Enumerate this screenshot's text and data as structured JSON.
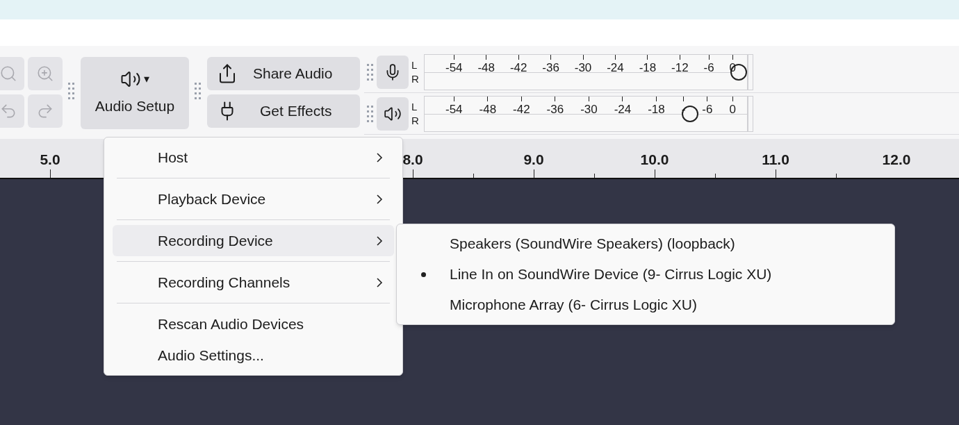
{
  "toolbar": {
    "audio_setup": {
      "label": "Audio Setup",
      "caret": "▾"
    },
    "share_audio": {
      "label": "Share Audio"
    },
    "get_effects": {
      "label": "Get Effects"
    }
  },
  "meters": [
    {
      "kind": "record",
      "top": "L",
      "bottom": "R",
      "ticks": [
        "-54",
        "-48",
        "-42",
        "-36",
        "-30",
        "-24",
        "-18",
        "-12",
        "-6",
        "0"
      ],
      "level": 1.0
    },
    {
      "kind": "playback",
      "top": "L",
      "bottom": "R",
      "ticks": [
        "-54",
        "-48",
        "-42",
        "-36",
        "-30",
        "-24",
        "-18",
        "-",
        "-6",
        "0"
      ],
      "level": 0.84
    }
  ],
  "ruler": {
    "labels": [
      "5.0",
      "8.0",
      "9.0",
      "10.0",
      "11.0",
      "12.0"
    ]
  },
  "menu": {
    "items": [
      {
        "label": "Host",
        "submenu": true,
        "selected": false
      },
      {
        "label": "Playback Device",
        "submenu": true,
        "selected": false
      },
      {
        "label": "Recording Device",
        "submenu": true,
        "selected": true
      },
      {
        "label": "Recording Channels",
        "submenu": true,
        "selected": false
      },
      {
        "label": "Rescan Audio Devices",
        "submenu": false,
        "selected": false
      },
      {
        "label": "Audio Settings...",
        "submenu": false,
        "selected": false
      }
    ]
  },
  "submenu": {
    "items": [
      {
        "label": "Speakers (SoundWire Speakers) (loopback)",
        "selected": false
      },
      {
        "label": "Line In on SoundWire Device (9- Cirrus Logic XU)",
        "selected": true
      },
      {
        "label": "Microphone Array (6- Cirrus Logic XU)",
        "selected": false
      }
    ]
  }
}
